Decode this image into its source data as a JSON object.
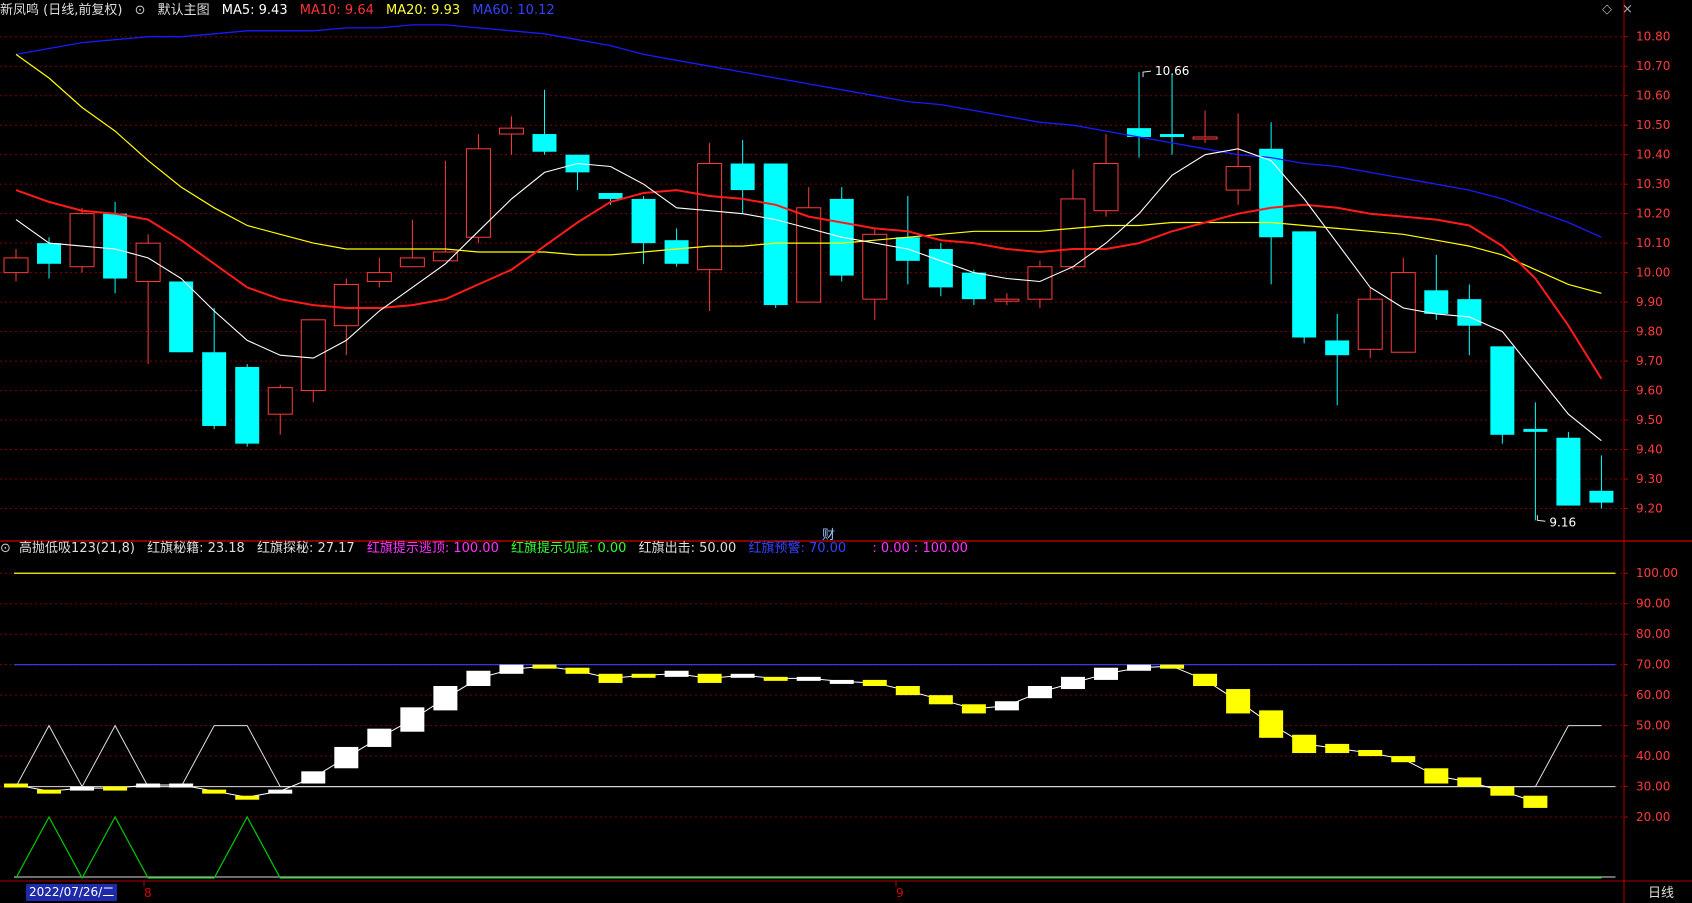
{
  "main_header": {
    "stock": "新凤鸣 (日线,前复权)",
    "indicator": "默认主图",
    "ma5": "MA5: 9.43",
    "ma10": "MA10: 9.64",
    "ma20": "MA20: 9.93",
    "ma60": "MA60: 10.12"
  },
  "sub_header": {
    "indicator": "高抛低吸123(21,8)",
    "secret": "红旗秘籍: 23.18",
    "explore": "红旗探秘: 27.17",
    "top_hint": "红旗提示逃顶: 100.00",
    "bottom_hint": "红旗提示见底: 0.00",
    "exit": "红旗出击: 50.00",
    "warn": "红旗预警: 70.00",
    "extra": ": 0.00 : 100.00"
  },
  "footer": {
    "date": "2022/07/26/二",
    "month_8": "8",
    "month_9": "9",
    "period": "日线"
  },
  "cai_marker": "财",
  "colors": {
    "up": "#ff3b3b",
    "down": "#00ffff",
    "ma5": "#ffffff",
    "ma10": "#ff1a1a",
    "ma20": "#ffff00",
    "ma60": "#1a1aff"
  },
  "chart_data": [
    {
      "type": "candlestick",
      "y_ticks": [
        "10.80",
        "10.70",
        "10.60",
        "10.50",
        "10.40",
        "10.30",
        "10.20",
        "10.10",
        "10.00",
        "9.90",
        "9.80",
        "9.70",
        "9.60",
        "9.50",
        "9.40",
        "9.30",
        "9.20"
      ],
      "ylim": [
        9.1,
        10.85
      ],
      "candles": [
        [
          10.0,
          10.05,
          10.08,
          9.97
        ],
        [
          10.1,
          10.03,
          10.12,
          9.98
        ],
        [
          10.02,
          10.2,
          10.22,
          10.0
        ],
        [
          10.2,
          9.98,
          10.24,
          9.93
        ],
        [
          9.97,
          10.1,
          10.13,
          9.69
        ],
        [
          9.97,
          9.73,
          9.97,
          9.73
        ],
        [
          9.73,
          9.48,
          9.88,
          9.47
        ],
        [
          9.68,
          9.42,
          9.69,
          9.41
        ],
        [
          9.52,
          9.61,
          9.62,
          9.45
        ],
        [
          9.6,
          9.84,
          9.84,
          9.56
        ],
        [
          9.82,
          9.96,
          9.98,
          9.72
        ],
        [
          9.97,
          10.0,
          10.05,
          9.95
        ],
        [
          10.02,
          10.05,
          10.18,
          10.02
        ],
        [
          10.04,
          10.07,
          10.38,
          10.04
        ],
        [
          10.12,
          10.42,
          10.47,
          10.1
        ],
        [
          10.47,
          10.49,
          10.53,
          10.4
        ],
        [
          10.47,
          10.41,
          10.62,
          10.4
        ],
        [
          10.4,
          10.34,
          10.4,
          10.28
        ],
        [
          10.27,
          10.25,
          10.27,
          10.23
        ],
        [
          10.25,
          10.1,
          10.26,
          10.03
        ],
        [
          10.11,
          10.03,
          10.15,
          10.02
        ],
        [
          10.01,
          10.37,
          10.44,
          9.87
        ],
        [
          10.37,
          10.28,
          10.45,
          10.2
        ],
        [
          10.37,
          9.89,
          10.37,
          9.88
        ],
        [
          9.9,
          10.22,
          10.29,
          9.9
        ],
        [
          10.25,
          9.99,
          10.29,
          9.97
        ],
        [
          9.91,
          10.13,
          10.15,
          9.84
        ],
        [
          10.12,
          10.04,
          10.26,
          9.96
        ],
        [
          10.08,
          9.95,
          10.1,
          9.92
        ],
        [
          10.0,
          9.91,
          10.01,
          9.89
        ],
        [
          9.91,
          9.91,
          9.93,
          9.89
        ],
        [
          9.91,
          10.02,
          10.04,
          9.88
        ],
        [
          10.02,
          10.25,
          10.35,
          10.01
        ],
        [
          10.21,
          10.37,
          10.47,
          10.19
        ],
        [
          10.49,
          10.46,
          10.68,
          10.39
        ],
        [
          10.47,
          10.46,
          10.67,
          10.4
        ],
        [
          10.46,
          10.46,
          10.55,
          10.44
        ],
        [
          10.28,
          10.36,
          10.54,
          10.23
        ],
        [
          10.42,
          10.12,
          10.51,
          9.96
        ],
        [
          10.14,
          9.78,
          10.14,
          9.76
        ],
        [
          9.77,
          9.72,
          9.86,
          9.55
        ],
        [
          9.74,
          9.91,
          9.95,
          9.71
        ],
        [
          9.73,
          10.0,
          10.05,
          9.73
        ],
        [
          9.94,
          9.86,
          10.06,
          9.84
        ],
        [
          9.91,
          9.82,
          9.96,
          9.72
        ],
        [
          9.75,
          9.45,
          9.75,
          9.42
        ],
        [
          9.47,
          9.46,
          9.56,
          9.16
        ],
        [
          9.44,
          9.21,
          9.46,
          9.21
        ],
        [
          9.26,
          9.22,
          9.38,
          9.2
        ]
      ],
      "ma5": [
        10.18,
        10.1,
        10.09,
        10.08,
        10.05,
        9.98,
        9.87,
        9.77,
        9.72,
        9.71,
        9.77,
        9.87,
        9.95,
        10.03,
        10.14,
        10.25,
        10.34,
        10.37,
        10.36,
        10.3,
        10.22,
        10.21,
        10.2,
        10.18,
        10.15,
        10.12,
        10.1,
        10.08,
        10.04,
        10.0,
        9.98,
        9.97,
        10.02,
        10.1,
        10.2,
        10.33,
        10.4,
        10.42,
        10.38,
        10.25,
        10.1,
        9.95,
        9.88,
        9.86,
        9.85,
        9.8,
        9.66,
        9.52,
        9.43
      ],
      "ma10": [
        10.28,
        10.24,
        10.21,
        10.2,
        10.18,
        10.11,
        10.03,
        9.95,
        9.91,
        9.89,
        9.88,
        9.88,
        9.89,
        9.91,
        9.96,
        10.01,
        10.09,
        10.17,
        10.24,
        10.27,
        10.28,
        10.26,
        10.25,
        10.23,
        10.19,
        10.17,
        10.15,
        10.14,
        10.11,
        10.1,
        10.08,
        10.07,
        10.08,
        10.08,
        10.1,
        10.14,
        10.17,
        10.2,
        10.22,
        10.23,
        10.22,
        10.2,
        10.19,
        10.18,
        10.16,
        10.09,
        9.98,
        9.82,
        9.64
      ],
      "ma20": [
        10.74,
        10.66,
        10.56,
        10.48,
        10.38,
        10.29,
        10.22,
        10.16,
        10.13,
        10.1,
        10.08,
        10.08,
        10.08,
        10.08,
        10.07,
        10.07,
        10.07,
        10.06,
        10.06,
        10.07,
        10.08,
        10.09,
        10.09,
        10.1,
        10.1,
        10.1,
        10.11,
        10.12,
        10.13,
        10.14,
        10.14,
        10.14,
        10.15,
        10.16,
        10.16,
        10.17,
        10.17,
        10.17,
        10.17,
        10.16,
        10.15,
        10.14,
        10.13,
        10.11,
        10.09,
        10.06,
        10.01,
        9.96,
        9.93
      ],
      "ma60": [
        10.74,
        10.76,
        10.78,
        10.79,
        10.8,
        10.8,
        10.81,
        10.82,
        10.82,
        10.82,
        10.83,
        10.83,
        10.84,
        10.84,
        10.83,
        10.82,
        10.81,
        10.79,
        10.77,
        10.74,
        10.72,
        10.7,
        10.68,
        10.66,
        10.64,
        10.62,
        10.6,
        10.58,
        10.57,
        10.55,
        10.53,
        10.51,
        10.5,
        10.48,
        10.46,
        10.44,
        10.42,
        10.4,
        10.39,
        10.37,
        10.36,
        10.34,
        10.32,
        10.3,
        10.28,
        10.25,
        10.21,
        10.17,
        10.12
      ],
      "annotations": [
        {
          "label": "10.66",
          "index": 34
        },
        {
          "label": "9.16",
          "index": 46
        }
      ]
    },
    {
      "type": "indicator",
      "y_ticks": [
        "100.00",
        "90.00",
        "80.00",
        "70.00",
        "60.00",
        "50.00",
        "40.00",
        "30.00",
        "20.00"
      ],
      "ylim": [
        0,
        105
      ],
      "levels": {
        "top": 100,
        "warn": 70,
        "exit": 50,
        "base": 30,
        "bottom": 0
      },
      "blocks": [
        [
          31,
          30,
          "y"
        ],
        [
          29,
          28,
          "y"
        ],
        [
          30,
          29,
          "w"
        ],
        [
          30,
          29,
          "y"
        ],
        [
          31,
          30,
          "w"
        ],
        [
          31,
          30,
          "w"
        ],
        [
          29,
          28,
          "y"
        ],
        [
          27,
          26,
          "y"
        ],
        [
          29,
          28,
          "w"
        ],
        [
          35,
          31,
          "w"
        ],
        [
          43,
          36,
          "w"
        ],
        [
          49,
          43,
          "w"
        ],
        [
          56,
          48,
          "w"
        ],
        [
          63,
          55,
          "w"
        ],
        [
          68,
          63,
          "w"
        ],
        [
          70,
          67,
          "w"
        ],
        [
          70,
          69,
          "y"
        ],
        [
          69,
          67,
          "y"
        ],
        [
          67,
          64,
          "y"
        ],
        [
          67,
          66,
          "y"
        ],
        [
          68,
          66,
          "w"
        ],
        [
          67,
          64,
          "y"
        ],
        [
          67,
          66,
          "w"
        ],
        [
          66,
          65,
          "y"
        ],
        [
          66,
          65,
          "w"
        ],
        [
          65,
          64,
          "w"
        ],
        [
          65,
          63,
          "y"
        ],
        [
          63,
          60,
          "y"
        ],
        [
          60,
          57,
          "y"
        ],
        [
          57,
          54,
          "y"
        ],
        [
          58,
          55,
          "w"
        ],
        [
          63,
          59,
          "w"
        ],
        [
          66,
          62,
          "w"
        ],
        [
          69,
          65,
          "w"
        ],
        [
          70,
          68,
          "w"
        ],
        [
          70,
          69,
          "y"
        ],
        [
          67,
          63,
          "y"
        ],
        [
          62,
          54,
          "y"
        ],
        [
          55,
          46,
          "y"
        ],
        [
          47,
          41,
          "y"
        ],
        [
          44,
          41,
          "y"
        ],
        [
          42,
          40,
          "y"
        ],
        [
          40,
          38,
          "y"
        ],
        [
          36,
          31,
          "y"
        ],
        [
          33,
          30,
          "y"
        ],
        [
          30,
          27,
          "y"
        ],
        [
          27,
          23,
          "y"
        ]
      ],
      "signal": [
        30,
        50,
        30,
        50,
        30,
        30,
        50,
        50,
        30,
        30,
        30,
        30,
        30,
        30,
        30,
        30,
        30,
        30,
        30,
        30,
        30,
        30,
        30,
        30,
        30,
        30,
        30,
        30,
        30,
        30,
        30,
        30,
        30,
        30,
        30,
        30,
        30,
        30,
        30,
        30,
        30,
        30,
        30,
        30,
        30,
        30,
        30,
        50,
        50
      ],
      "green": [
        0,
        20,
        0,
        20,
        0,
        0,
        0,
        20,
        0,
        0,
        0,
        0,
        0,
        0,
        0,
        0,
        0,
        0,
        0,
        0,
        0,
        0,
        0,
        0,
        0,
        0,
        0,
        0,
        0,
        0,
        0,
        0,
        0,
        0,
        0,
        0,
        0,
        0,
        0,
        0,
        0,
        0,
        0,
        0,
        0,
        0,
        0,
        0,
        0
      ]
    }
  ]
}
